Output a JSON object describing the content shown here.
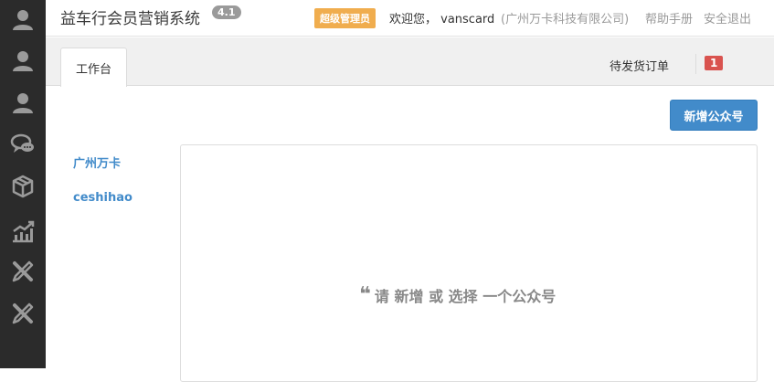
{
  "app": {
    "title": "益车行会员营销系统",
    "version": "4.1"
  },
  "header": {
    "role_badge": "超级管理员",
    "welcome": "欢迎您， vanscard",
    "company": "(广州万卡科技有限公司)",
    "help_label": "帮助手册",
    "logout_label": "安全退出"
  },
  "sidebar": {
    "items": [
      {
        "icon": "user-icon"
      },
      {
        "icon": "user-icon"
      },
      {
        "icon": "user-icon"
      },
      {
        "icon": "chat-icon"
      },
      {
        "icon": "cube-icon"
      },
      {
        "icon": "chart-icon"
      },
      {
        "icon": "tools-icon"
      },
      {
        "icon": "tools-icon"
      }
    ]
  },
  "tabs": {
    "active_label": "工作台",
    "pending_label": "待发货订单",
    "pending_count": "1"
  },
  "main": {
    "add_button_label": "新增公众号",
    "accounts": [
      "广州万卡",
      "ceshihao"
    ],
    "empty_message": "请 新增 或 选择 一个公众号"
  },
  "colors": {
    "sidebar_bg": "#2b2b2b",
    "icon": "#9a9a9a",
    "primary": "#428bca",
    "warning": "#f0ad4e",
    "danger": "#d9534f"
  }
}
